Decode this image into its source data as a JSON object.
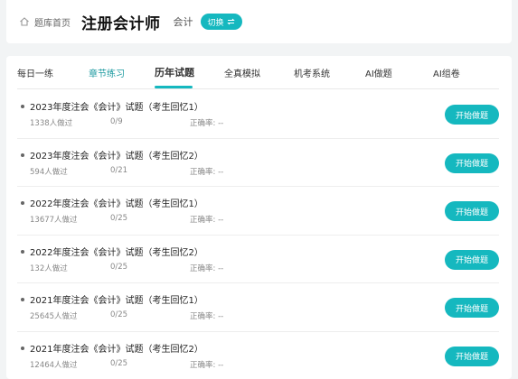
{
  "header": {
    "breadcrumb": "题库首页",
    "title": "注册会计师",
    "subject": "会计",
    "switch_label": "切换"
  },
  "tabs": [
    {
      "label": "每日一练"
    },
    {
      "label": "章节练习"
    },
    {
      "label": "历年试题"
    },
    {
      "label": "全真模拟"
    },
    {
      "label": "机考系统"
    },
    {
      "label": "AI做题"
    },
    {
      "label": "AI组卷"
    }
  ],
  "papers": [
    {
      "name": "2023年度注会《会计》试题（考生回忆1）",
      "people": "1338人做过",
      "progress": "0/9",
      "accuracy": "正确率: --",
      "button": "开始做题"
    },
    {
      "name": "2023年度注会《会计》试题（考生回忆2）",
      "people": "594人做过",
      "progress": "0/21",
      "accuracy": "正确率: --",
      "button": "开始做题"
    },
    {
      "name": "2022年度注会《会计》试题（考生回忆1）",
      "people": "13677人做过",
      "progress": "0/25",
      "accuracy": "正确率: --",
      "button": "开始做题"
    },
    {
      "name": "2022年度注会《会计》试题（考生回忆2）",
      "people": "132人做过",
      "progress": "0/25",
      "accuracy": "正确率: --",
      "button": "开始做题"
    },
    {
      "name": "2021年度注会《会计》试题（考生回忆1）",
      "people": "25645人做过",
      "progress": "0/25",
      "accuracy": "正确率: --",
      "button": "开始做题"
    },
    {
      "name": "2021年度注会《会计》试题（考生回忆2）",
      "people": "12464人做过",
      "progress": "0/25",
      "accuracy": "正确率: --",
      "button": "开始做题"
    }
  ],
  "colors": {
    "accent": "#15b8bf",
    "background": "#f2f4f5"
  }
}
